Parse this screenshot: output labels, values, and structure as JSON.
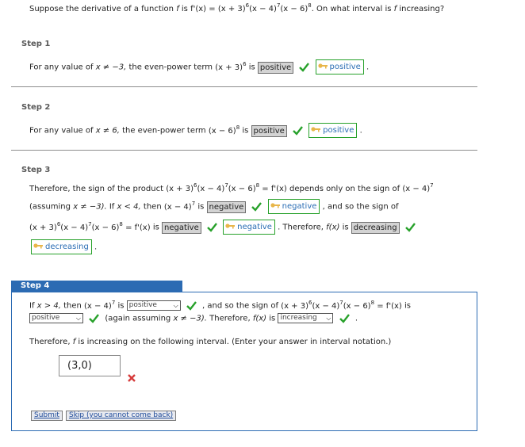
{
  "question": {
    "prefix": "Suppose the derivative of a function",
    "f": "f",
    "is": "is",
    "deriv": "f'(x) = (x + 3)",
    "e1": "6",
    "mid": "(x − 4)",
    "e2": "7",
    "mid2": "(x − 6)",
    "e3": "8",
    "suffix": ". On what interval is",
    "f2": "f",
    "suffix2": "increasing?"
  },
  "step1": {
    "label": "Step 1",
    "text1": "For any value of",
    "cond": "x ≠ −3,",
    "text2": "the even-power term",
    "term": "(x + 3)",
    "exp": "6",
    "is": "is",
    "answer_box": "positive",
    "key_answer": "positive",
    "dot": "."
  },
  "step2": {
    "label": "Step 2",
    "text1": "For any value of",
    "cond": "x ≠ 6,",
    "text2": "the even-power term",
    "term": "(x − 6)",
    "exp": "8",
    "is": "is",
    "answer_box": "positive",
    "key_answer": "positive",
    "dot": "."
  },
  "step3": {
    "label": "Step 3",
    "l1a": "Therefore, the sign of the product",
    "l1b": "(x + 3)",
    "l1b_e": "6",
    "l1c": "(x − 4)",
    "l1c_e": "7",
    "l1d": "(x − 6)",
    "l1d_e": "8",
    "l1e": "= f'(x)",
    "l1f": "depends only on the sign of",
    "l1g": "(x − 4)",
    "l1g_e": "7",
    "l2a": "(assuming",
    "l2b": "x ≠ −3).",
    "l2c": "If",
    "l2d": "x < 4,",
    "l2e": "then",
    "l2f": "(x − 4)",
    "l2f_e": "7",
    "l2g": "is",
    "l2_box": "negative",
    "l2_key": "negative",
    "l2h": ", and so the sign of",
    "l3a": "(x + 3)",
    "l3a_e": "6",
    "l3b": "(x − 4)",
    "l3b_e": "7",
    "l3c": "(x − 6)",
    "l3c_e": "8",
    "l3d": "= f'(x)",
    "l3e": "is",
    "l3_box": "negative",
    "l3_key": "negative",
    "l3f": ". Therefore,",
    "l3g": "f(x)",
    "l3h": "is",
    "l3_box2": "decreasing",
    "l4_key": "decreasing",
    "dot": "."
  },
  "step4": {
    "label": "Step 4",
    "l1a": "If",
    "l1b": "x > 4,",
    "l1c": "then",
    "l1d": "(x − 4)",
    "l1d_e": "7",
    "l1e": "is",
    "sel1": "positive",
    "l1f": ", and so the sign of",
    "l1g": "(x + 3)",
    "l1g_e": "6",
    "l1h": "(x − 4)",
    "l1h_e": "7",
    "l1i": "(x − 6)",
    "l1i_e": "8",
    "l1j": "= f'(x)",
    "l1k": "is",
    "sel2": "positive",
    "l2a": "(again assuming",
    "l2b": "x ≠ −3).",
    "l2c": "Therefore,",
    "l2d": "f(x)",
    "l2e": "is",
    "sel3": "increasing",
    "dot": ".",
    "l3a": "Therefore,",
    "l3b": "f",
    "l3c": "is increasing on the following interval. (Enter your answer in interval notation.)",
    "answer_value": "(3,0)",
    "submit_label": "Submit",
    "skip_label": "Skip (you cannot come back)"
  },
  "colors": {
    "accent": "#2c6bb3",
    "correct": "#27a12a",
    "incorrect": "#d63b3b"
  },
  "icons": [
    "check-icon",
    "key-icon",
    "cross-icon",
    "chevron-down-icon"
  ]
}
